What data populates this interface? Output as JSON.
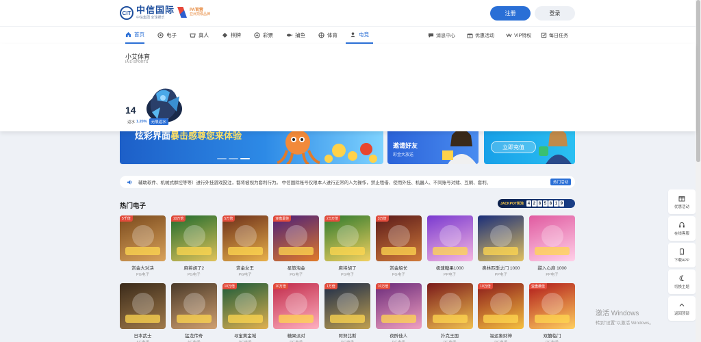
{
  "header": {
    "logo_mark": "CIT",
    "logo_title": "中信国际",
    "logo_sub": "中信集团  全球娱乐",
    "partner_line1": "PA官营",
    "partner_line2": "亚洲顶级品牌",
    "register_label": "注册",
    "login_label": "登录"
  },
  "nav": {
    "items": [
      {
        "label": "首页",
        "icon": "home-icon",
        "active": true
      },
      {
        "label": "电子",
        "icon": "slot-icon"
      },
      {
        "label": "真人",
        "icon": "live-icon"
      },
      {
        "label": "棋牌",
        "icon": "cards-icon"
      },
      {
        "label": "彩票",
        "icon": "lottery-icon"
      },
      {
        "label": "捕鱼",
        "icon": "fish-icon"
      },
      {
        "label": "体育",
        "icon": "sports-icon"
      },
      {
        "label": "电竞",
        "icon": "esports-icon",
        "hovered": true
      }
    ],
    "right_items": [
      {
        "label": "消息中心",
        "icon": "message-icon"
      },
      {
        "label": "优惠活动",
        "icon": "gift-icon"
      },
      {
        "label": "VIP特权",
        "icon": "vip-icon"
      },
      {
        "label": "每日任务",
        "icon": "task-icon"
      }
    ]
  },
  "dropdown": {
    "title": "小艾体育",
    "subtitle": "IA E-SPORTS",
    "card_number": "14",
    "rate_label": "返水",
    "rate": "1.20%",
    "pill": "无限返水"
  },
  "banner": {
    "text_a": "炫彩界面",
    "text_b": "暴击感",
    "text_c": "尊您来体验"
  },
  "promo1": {
    "title": "邀请好友",
    "subtitle": "彩金大放送"
  },
  "promo2": {
    "button": "立即充值"
  },
  "notice": {
    "text": "辅助软件、机械式群控等等）进行外挂游戏投注，都将被视为套利行为。 中信国际账号仅限本人进行正常的人为操作，禁止租借、使用外挂、机器人、不同账号对赌、互刷、套利、",
    "button": "热门活动"
  },
  "hot": {
    "title": "热门电子",
    "jackpot_label": "JACKPOT奖池",
    "jackpot_digits": [
      "4",
      "2",
      "8",
      "5",
      "8",
      "1",
      "9"
    ]
  },
  "games_row1": [
    {
      "name": "赏金大对决",
      "provider": "PG电子",
      "tag": "5千倍",
      "c1": "#7a4a1e",
      "c2": "#d9a25a"
    },
    {
      "name": "麻将胡了2",
      "provider": "PG电子",
      "tag": "10万倍",
      "c1": "#1f6b2e",
      "c2": "#e0c25a"
    },
    {
      "name": "赏金女王",
      "provider": "PG电子",
      "tag": "5万倍",
      "c1": "#6b2e1a",
      "c2": "#e8b04a"
    },
    {
      "name": "星旅淘金",
      "provider": "PG电子",
      "tag": "亚盘最佳",
      "c1": "#4a1f7a",
      "c2": "#e07a2a"
    },
    {
      "name": "麻将胡了",
      "provider": "PG电子",
      "tag": "2.5万倍",
      "c1": "#2e7a2e",
      "c2": "#f2d060"
    },
    {
      "name": "赏金船长",
      "provider": "PG电子",
      "tag": "3万倍",
      "c1": "#5a1a1a",
      "c2": "#d07a3a"
    },
    {
      "name": "极速糖果1000",
      "provider": "PP电子",
      "tag": "",
      "c1": "#7a3ad0",
      "c2": "#f5b6e0"
    },
    {
      "name": "奥林匹斯之门 1000",
      "provider": "PP电子",
      "tag": "",
      "c1": "#1a2e7a",
      "c2": "#e0c060"
    },
    {
      "name": "甜入心扉 1000",
      "provider": "PP电子",
      "tag": "",
      "c1": "#e05aa0",
      "c2": "#ffd0e8"
    }
  ],
  "games_row2": [
    {
      "name": "日本武士",
      "provider": "AG电子",
      "tag": "",
      "c1": "#3a2a1a",
      "c2": "#a07a4a"
    },
    {
      "name": "猛龙传奇",
      "provider": "AG电子",
      "tag": "",
      "c1": "#4a3a2a",
      "c2": "#d0a070"
    },
    {
      "name": "寻宝黄金城",
      "provider": "PG电子",
      "tag": "10万倍",
      "c1": "#1a5a3a",
      "c2": "#e0b050"
    },
    {
      "name": "糖果派对",
      "provider": "PG电子",
      "tag": "10万倍",
      "c1": "#c02a4a",
      "c2": "#ffb0c0"
    },
    {
      "name": "阿努比斯",
      "provider": "PG电子",
      "tag": "1万倍",
      "c1": "#1a2a4a",
      "c2": "#c0a050"
    },
    {
      "name": "夜醉佳人",
      "provider": "PG电子",
      "tag": "10万倍",
      "c1": "#6a2a7a",
      "c2": "#f0a0c0"
    },
    {
      "name": "扑克王国",
      "provider": "PG电子",
      "tag": "",
      "c1": "#7a1a1a",
      "c2": "#f0c050"
    },
    {
      "name": "福运象财神",
      "provider": "PG电子",
      "tag": "10万倍",
      "c1": "#8a1a1a",
      "c2": "#f5c040"
    },
    {
      "name": "双囍临门",
      "provider": "PG电子",
      "tag": "亚盘最佳",
      "c1": "#b01a1a",
      "c2": "#ffd060"
    }
  ],
  "sidebar": [
    {
      "label": "优惠活动",
      "icon": "gift-icon"
    },
    {
      "label": "在线客服",
      "icon": "headset-icon"
    },
    {
      "label": "下载APP",
      "icon": "phone-icon"
    },
    {
      "label": "切换主题",
      "icon": "moon-icon"
    },
    {
      "label": "返回顶部",
      "icon": "arrow-up-icon"
    }
  ],
  "watermark": {
    "line1": "激活 Windows",
    "line2": "转到\"设置\"以激活 Windows。"
  },
  "colors": {
    "primary": "#2a6fd6",
    "tag_red": "#e24b3b"
  }
}
